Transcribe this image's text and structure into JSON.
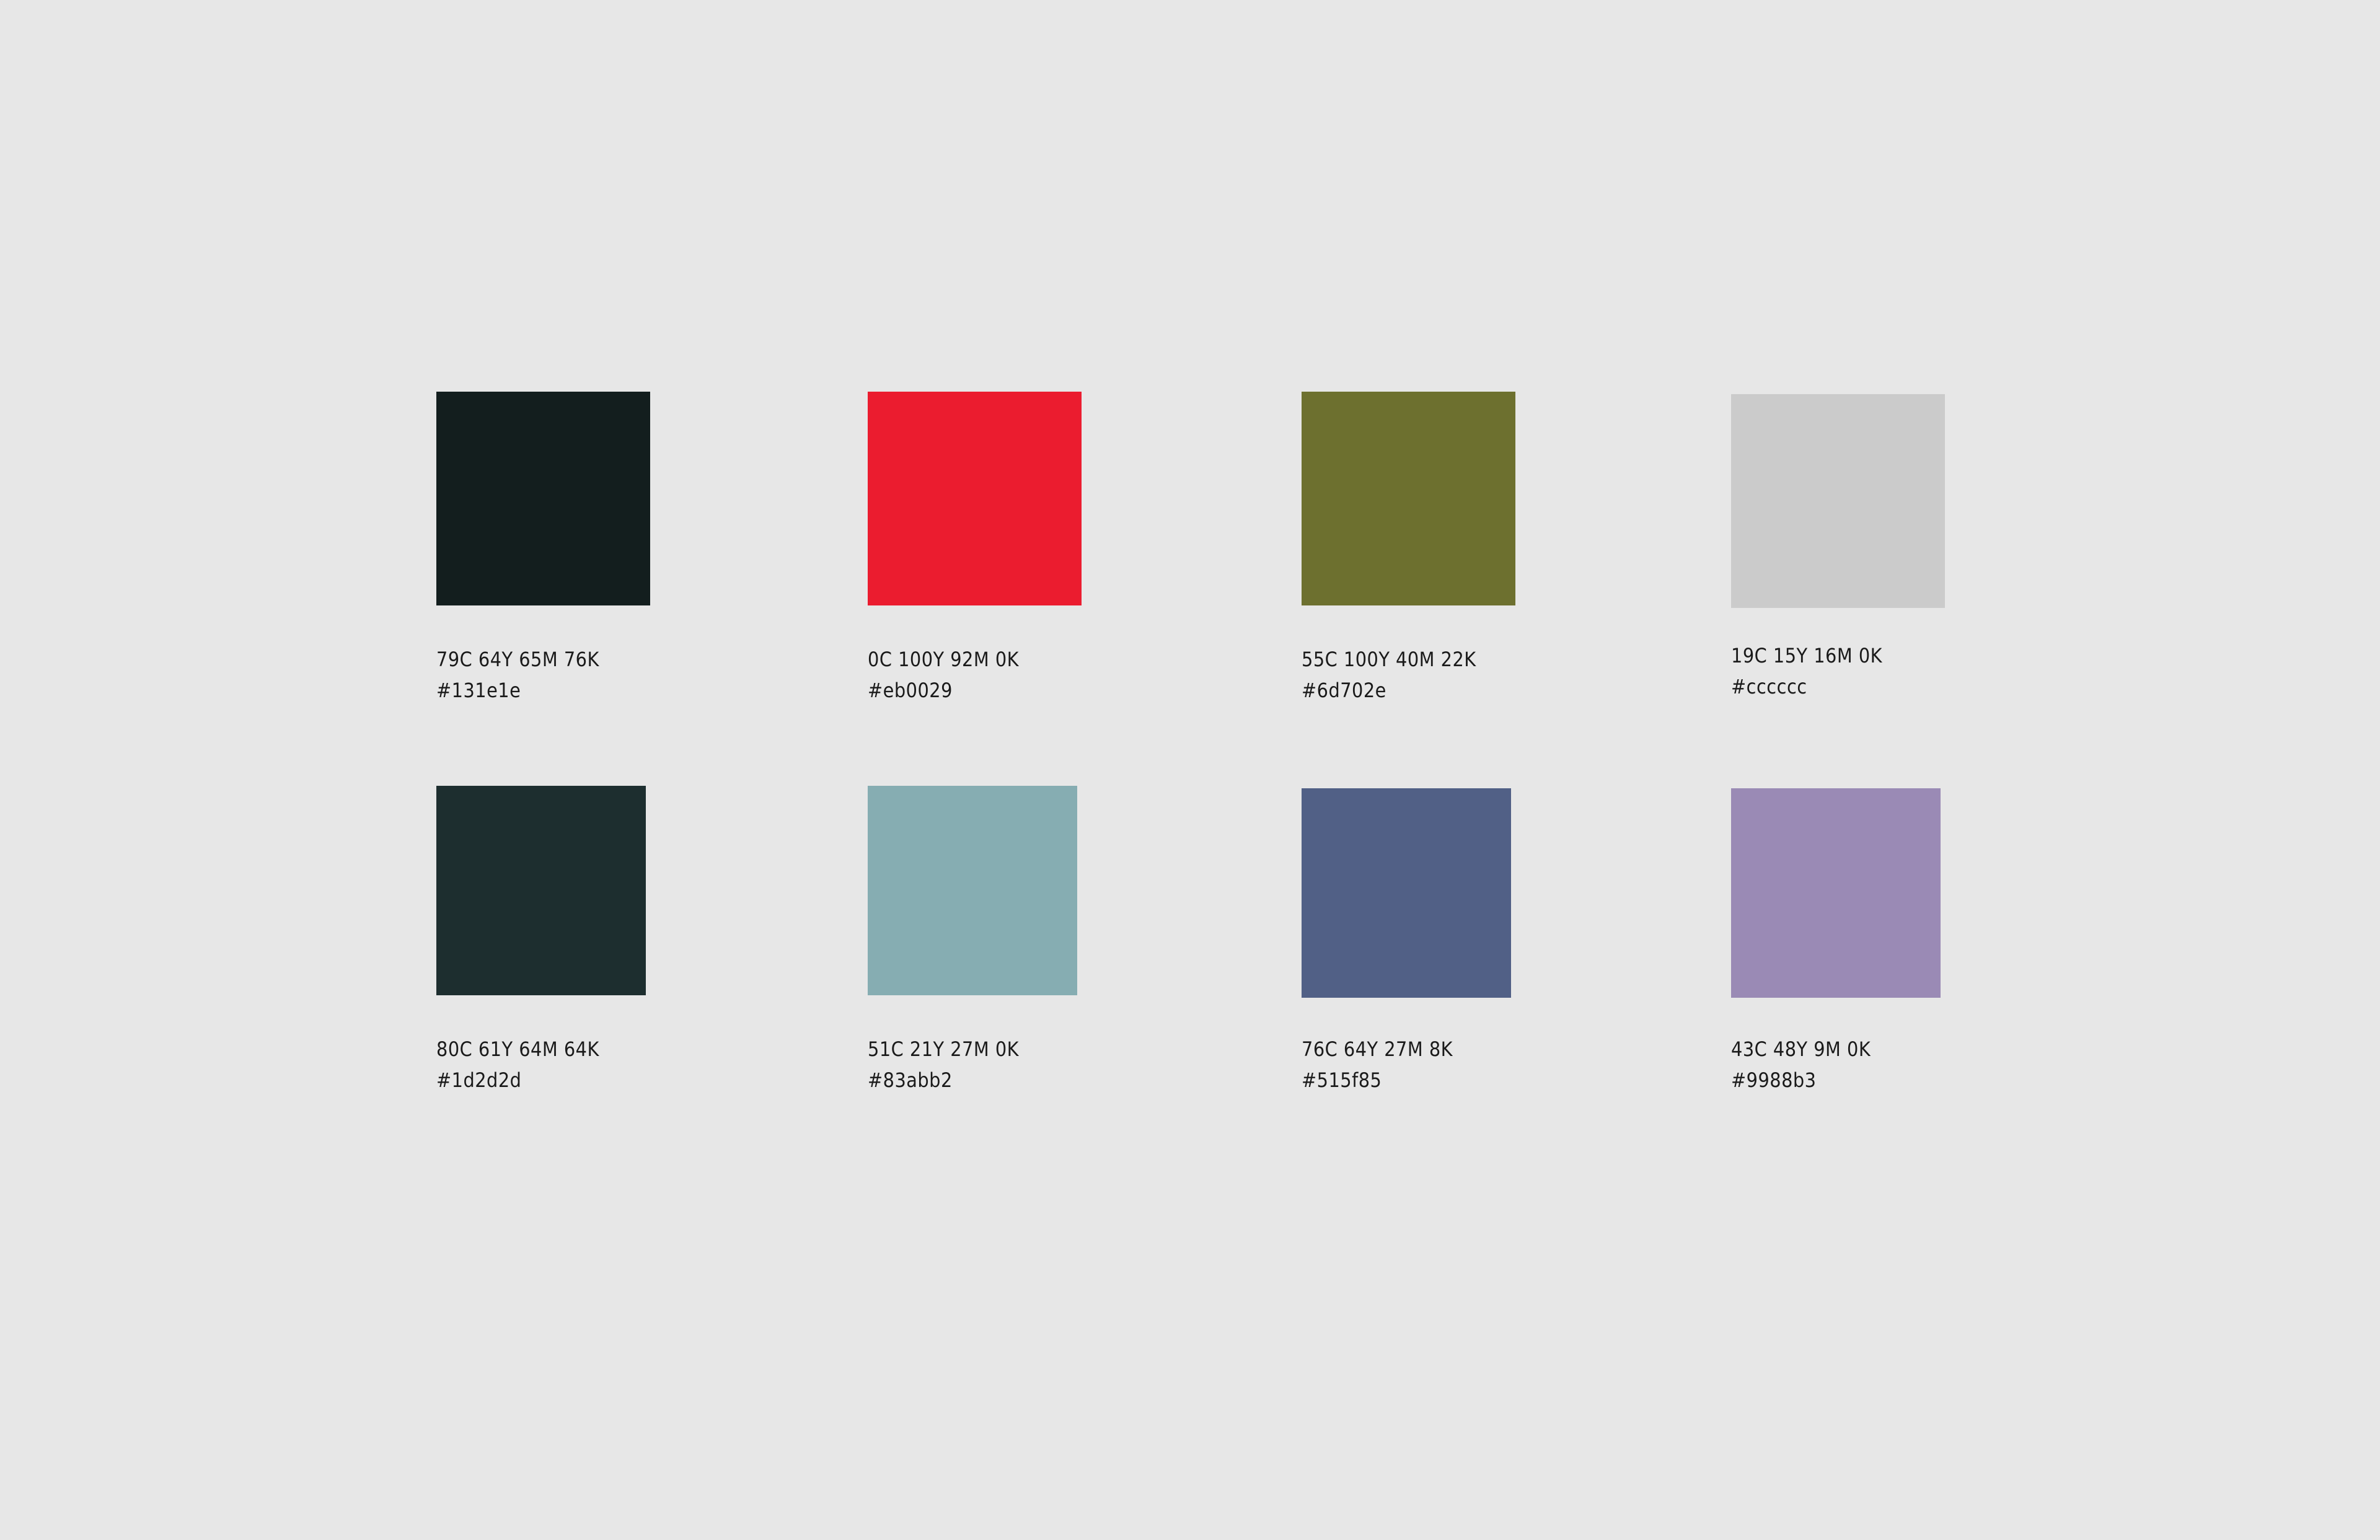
{
  "swatches": [
    {
      "cmyk": "79C 64Y 65M 76K",
      "hex": "#131e1e",
      "color": "#131e1e"
    },
    {
      "cmyk": "0C 100Y 92M 0K",
      "hex": "#eb0029",
      "color": "#eb1c2f"
    },
    {
      "cmyk": "55C 100Y 40M 22K",
      "hex": "#6d702e",
      "color": "#6d702f"
    },
    {
      "cmyk": "19C 15Y 16M 0K",
      "hex": "#cccccc",
      "color": "#cbcbcb"
    },
    {
      "cmyk": "80C 61Y 64M 64K",
      "hex": "#1d2d2d",
      "color": "#1d2e2f"
    },
    {
      "cmyk": "51C 21Y 27M 0K",
      "hex": "#83abb2",
      "color": "#86adb2"
    },
    {
      "cmyk": "76C 64Y 27M 8K",
      "hex": "#515f85",
      "color": "#516086"
    },
    {
      "cmyk": "43C 48Y 9M 0K",
      "hex": "#9988b3",
      "color": "#9a8ab5"
    }
  ]
}
